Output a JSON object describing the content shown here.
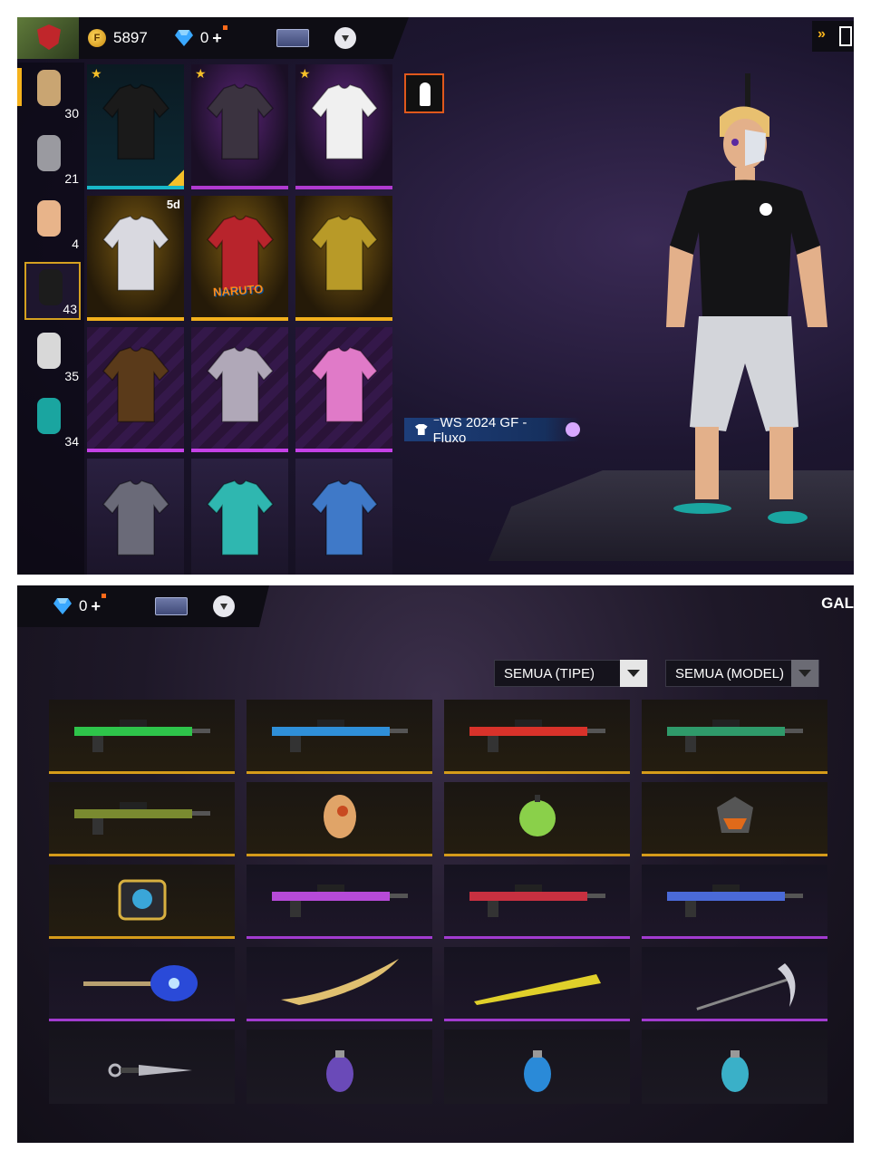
{
  "top": {
    "coins": "5897",
    "diamonds": "0",
    "plus": "+",
    "categories": [
      {
        "count": "30",
        "color": "#c9a572"
      },
      {
        "count": "21",
        "color": "#9a9aa0"
      },
      {
        "count": "4",
        "color": "#e8b48a"
      },
      {
        "count": "43",
        "color": "#1c1c1c"
      },
      {
        "count": "35",
        "color": "#d8d8d8"
      },
      {
        "count": "34",
        "color": "#1aa5a0"
      }
    ],
    "tiles": [
      {
        "style": "teal",
        "star": true,
        "corner": true,
        "timer": "",
        "naruto": "",
        "color": "#1a1a1a"
      },
      {
        "style": "purple",
        "star": true,
        "corner": false,
        "timer": "",
        "naruto": "",
        "color": "#3b3340"
      },
      {
        "style": "purple",
        "star": true,
        "corner": false,
        "timer": "",
        "naruto": "",
        "color": "#f0f0f0"
      },
      {
        "style": "gold",
        "star": false,
        "corner": false,
        "timer": "5d",
        "naruto": "",
        "color": "#d9d9e0"
      },
      {
        "style": "gold",
        "star": false,
        "corner": false,
        "timer": "",
        "naruto": "NARUTO",
        "color": "#b8242c"
      },
      {
        "style": "gold",
        "star": false,
        "corner": false,
        "timer": "",
        "naruto": "",
        "color": "#b89a28"
      },
      {
        "style": "stripe",
        "star": false,
        "corner": false,
        "timer": "",
        "naruto": "",
        "color": "#5a3a1a"
      },
      {
        "style": "stripe",
        "star": false,
        "corner": false,
        "timer": "",
        "naruto": "",
        "color": "#b0a8b8"
      },
      {
        "style": "stripe",
        "star": false,
        "corner": false,
        "timer": "",
        "naruto": "",
        "color": "#e07ac8"
      },
      {
        "style": "plain",
        "star": false,
        "corner": false,
        "timer": "",
        "naruto": "",
        "color": "#6a6a78"
      },
      {
        "style": "plain",
        "star": false,
        "corner": false,
        "timer": "",
        "naruto": "",
        "color": "#2fb7b0"
      },
      {
        "style": "plain",
        "star": false,
        "corner": false,
        "timer": "",
        "naruto": "",
        "color": "#3f79c8"
      }
    ],
    "outfit_name": "⁻WS 2024 GF - Fluxo"
  },
  "bottom": {
    "diamonds": "0",
    "plus": "+",
    "gal": "GAL",
    "filter_type": "SEMUA (TIPE)",
    "filter_model": "SEMUA (MODEL)",
    "weapons": [
      {
        "style": "gold",
        "kind": "rifle",
        "color": "#2ec44a"
      },
      {
        "style": "gold",
        "kind": "rifle",
        "color": "#2f8fd8"
      },
      {
        "style": "gold",
        "kind": "rifle",
        "color": "#d8322a"
      },
      {
        "style": "gold",
        "kind": "rifle",
        "color": "#2f9a6a"
      },
      {
        "style": "gold",
        "kind": "rifle",
        "color": "#7a8a30"
      },
      {
        "style": "gold",
        "kind": "egg",
        "color": "#e0a468"
      },
      {
        "style": "gold",
        "kind": "orb",
        "color": "#8ad04a"
      },
      {
        "style": "gold",
        "kind": "helmet",
        "color": "#e06a1a"
      },
      {
        "style": "gold",
        "kind": "badge",
        "color": "#3aa6d8"
      },
      {
        "style": "purple",
        "kind": "rifle",
        "color": "#b64ad8"
      },
      {
        "style": "purple",
        "kind": "rifle",
        "color": "#c83040"
      },
      {
        "style": "purple",
        "kind": "rifle",
        "color": "#4a6ad8"
      },
      {
        "style": "purple",
        "kind": "scepter",
        "color": "#2a4ad8"
      },
      {
        "style": "purple",
        "kind": "blade",
        "color": "#e0c070"
      },
      {
        "style": "purple",
        "kind": "bat",
        "color": "#e0d02a"
      },
      {
        "style": "purple",
        "kind": "scythe",
        "color": "#cfcfd8"
      },
      {
        "style": "plain",
        "kind": "kunai",
        "color": "#b8b8c0"
      },
      {
        "style": "plain",
        "kind": "grenade",
        "color": "#6a4ab8"
      },
      {
        "style": "plain",
        "kind": "grenade",
        "color": "#2a8ad8"
      },
      {
        "style": "plain",
        "kind": "grenade",
        "color": "#3ab0c8"
      }
    ]
  }
}
